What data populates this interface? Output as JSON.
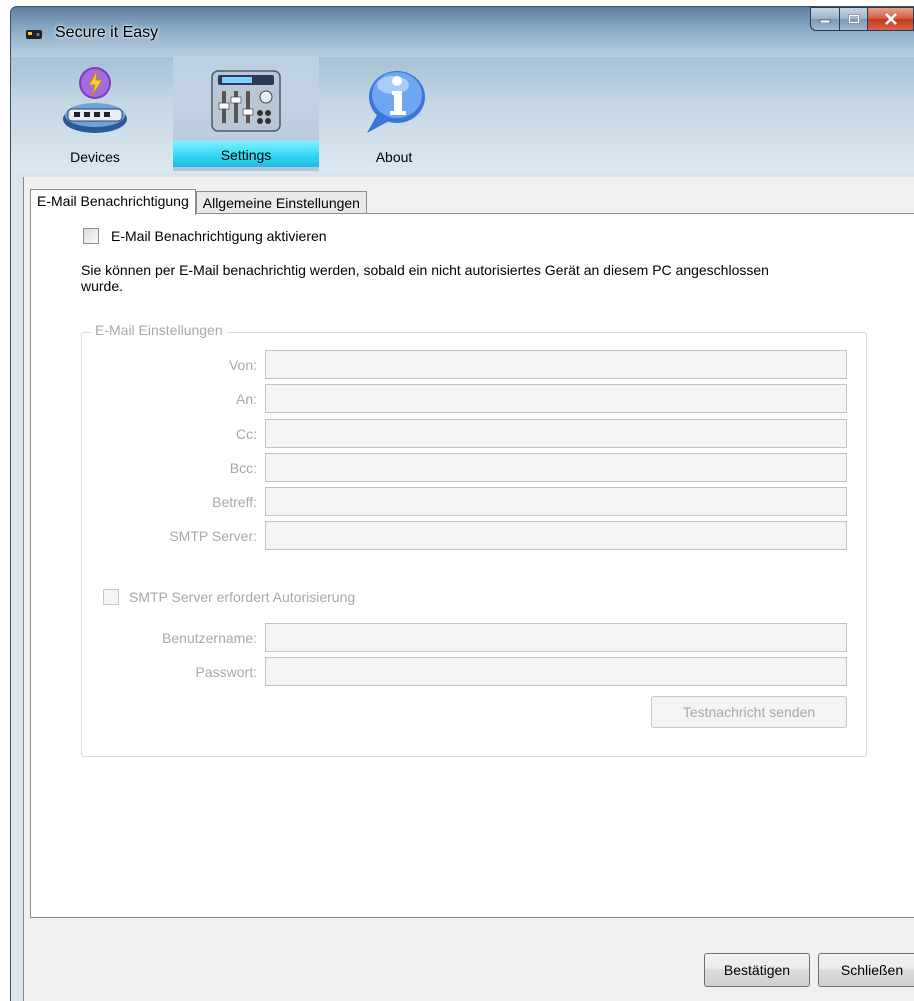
{
  "window": {
    "title": "Secure it Easy"
  },
  "toolbar": {
    "items": [
      {
        "label": "Devices",
        "icon": "usb-device-icon"
      },
      {
        "label": "Settings",
        "icon": "mixer-console-icon",
        "selected": true
      },
      {
        "label": "About",
        "icon": "info-bubble-icon"
      }
    ]
  },
  "tabs": [
    {
      "label": "E-Mail Benachrichtigung",
      "selected": true
    },
    {
      "label": "Allgemeine Einstellungen",
      "selected": false
    }
  ],
  "email": {
    "enable_label": "E-Mail Benachrichtigung aktivieren",
    "enable_checked": false,
    "description": "Sie können per E-Mail benachrichtig werden, sobald ein nicht autorisiertes Gerät an diesem PC angeschlossen wurde.",
    "group_title": "E-Mail Einstellungen",
    "fields": {
      "from_label": "Von:",
      "to_label": "An:",
      "cc_label": "Cc:",
      "bcc_label": "Bcc:",
      "subject_label": "Betreff:",
      "smtp_label": "SMTP Server:"
    },
    "auth_label": "SMTP Server erfordert Autorisierung",
    "auth_checked": false,
    "username_label": "Benutzername:",
    "password_label": "Passwort:",
    "test_button": "Testnachricht senden"
  },
  "footer": {
    "confirm_label": "Bestätigen",
    "close_label": "Schließen"
  },
  "colors": {
    "selected_tool_highlight": "#2fd6f2",
    "disabled_text": "#a8a8a8",
    "close_button": "#c23a1c"
  }
}
